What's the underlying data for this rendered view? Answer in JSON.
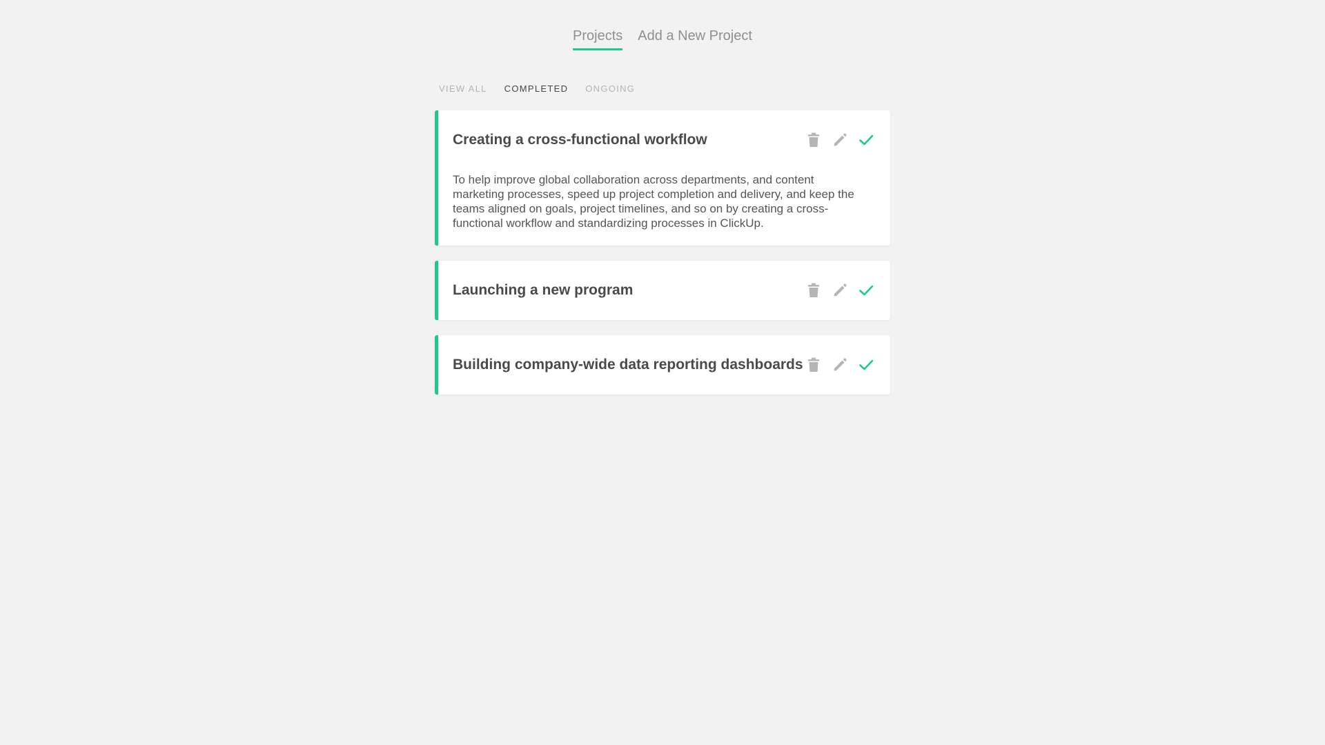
{
  "nav": {
    "tabs": [
      {
        "label": "Projects",
        "active": true
      },
      {
        "label": "Add a New Project",
        "active": false
      }
    ]
  },
  "filters": {
    "items": [
      {
        "label": "VIEW ALL",
        "active": false
      },
      {
        "label": "COMPLETED",
        "active": true
      },
      {
        "label": "ONGOING",
        "active": false
      }
    ]
  },
  "projects": [
    {
      "title": "Creating a cross-functional workflow",
      "description": "To help improve global collaboration across departments, and content marketing processes, speed up project completion and delivery, and keep the teams aligned on goals, project timelines, and so on by creating a cross-functional workflow and standardizing processes in ClickUp."
    },
    {
      "title": "Launching a new program",
      "description": ""
    },
    {
      "title": "Building company-wide data reporting dashboards",
      "description": ""
    }
  ],
  "icons": {
    "delete": "trash-icon",
    "edit": "pencil-icon",
    "complete": "check-icon"
  },
  "colors": {
    "accent": "#1ec98b",
    "icon_muted": "#b5b5b5",
    "background": "#f2f2f2"
  }
}
